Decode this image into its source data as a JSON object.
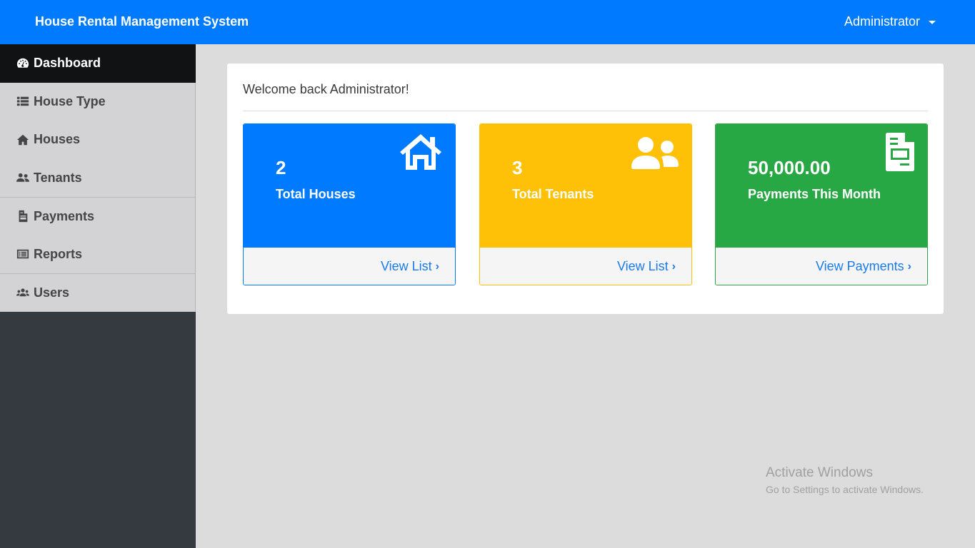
{
  "header": {
    "brand": "House Rental Management System",
    "account_label": "Administrator",
    "bg_color": "#007bff"
  },
  "sidebar": {
    "items": [
      {
        "label": "Dashboard",
        "icon": "tachometer-icon",
        "active": true
      },
      {
        "label": "House Type",
        "icon": "list-icon"
      },
      {
        "label": "Houses",
        "icon": "home-icon"
      },
      {
        "label": "Tenants",
        "icon": "user-friends-icon"
      },
      {
        "label": "Payments",
        "icon": "file-invoice-icon"
      },
      {
        "label": "Reports",
        "icon": "list-alt-icon"
      },
      {
        "label": "Users",
        "icon": "users-icon"
      }
    ]
  },
  "main": {
    "welcome": "Welcome back Administrator!",
    "stats": [
      {
        "value": "2",
        "label": "Total Houses",
        "link": "View List",
        "color": "#007bff",
        "icon": "home-icon"
      },
      {
        "value": "3",
        "label": "Total Tenants",
        "link": "View List",
        "color": "#ffc107",
        "icon": "user-friends-icon"
      },
      {
        "value": "50,000.00",
        "label": "Payments This Month",
        "link": "View Payments",
        "color": "#28a745",
        "icon": "file-invoice-icon"
      }
    ]
  },
  "watermark": {
    "line1": "Activate Windows",
    "line2": "Go to Settings to activate Windows."
  }
}
